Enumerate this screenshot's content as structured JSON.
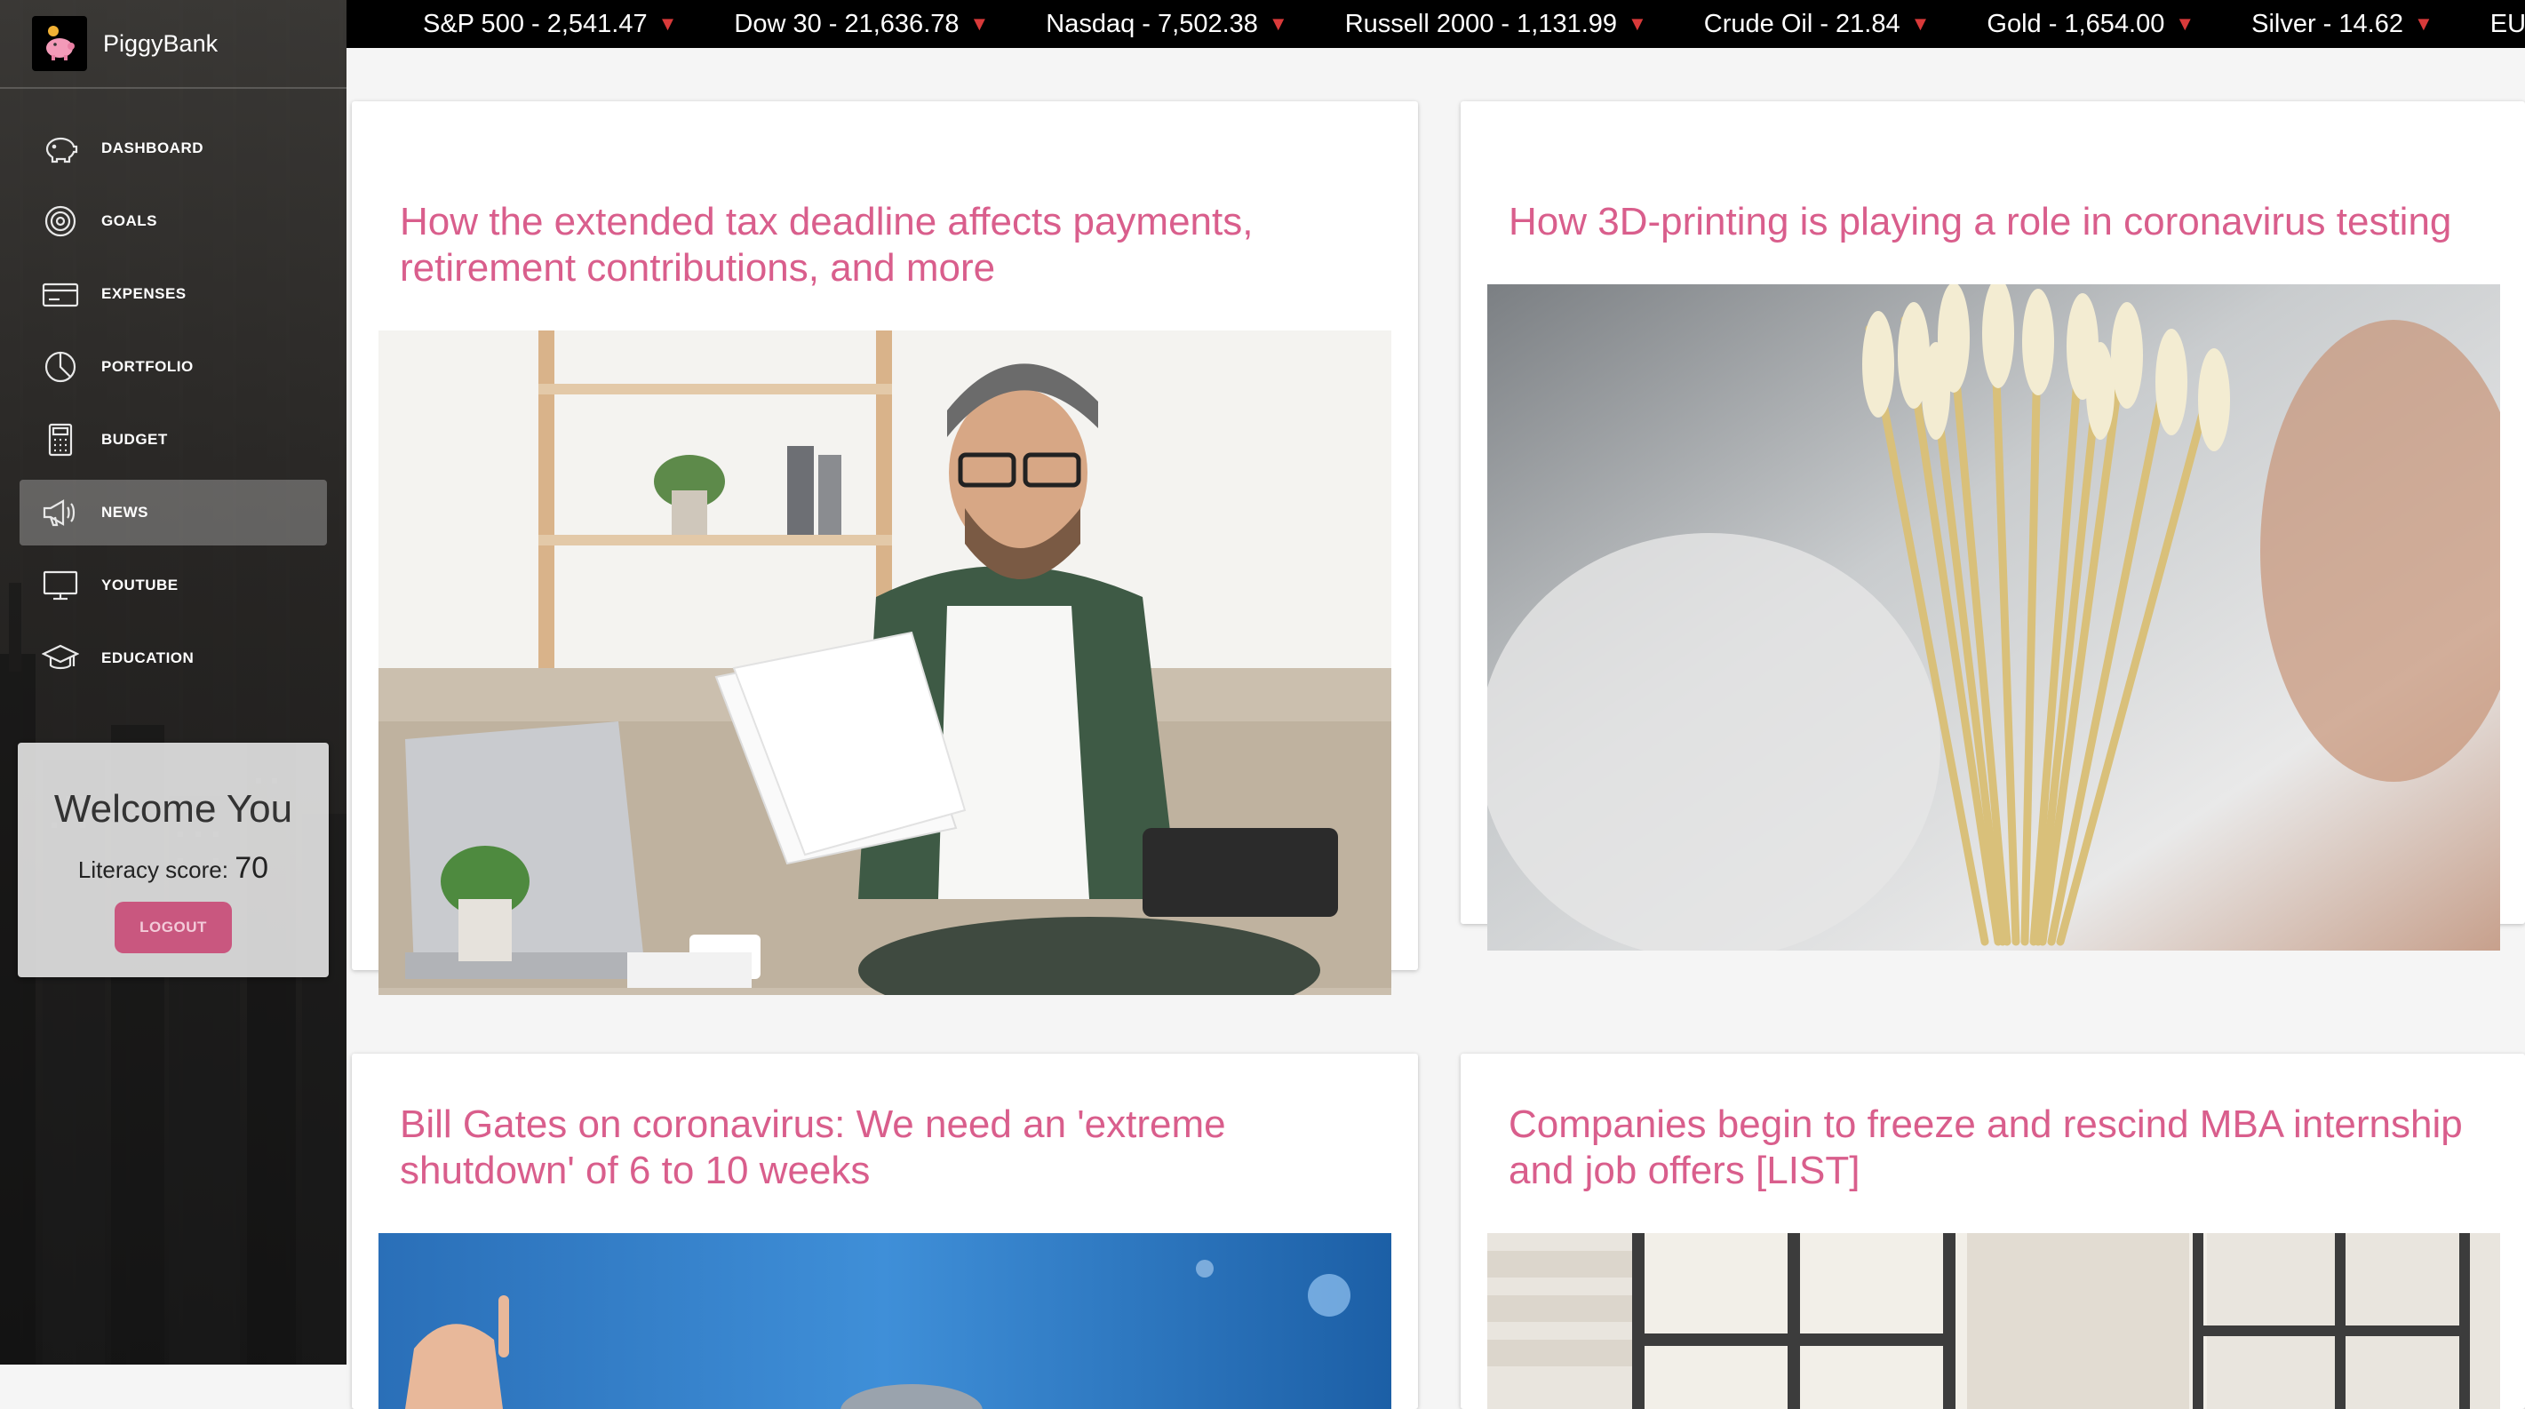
{
  "app": {
    "brand_name": "PiggyBank"
  },
  "sidebar": {
    "items": [
      {
        "label": "DASHBOARD",
        "icon": "piggy-bank-icon",
        "active": false
      },
      {
        "label": "GOALS",
        "icon": "target-icon",
        "active": false
      },
      {
        "label": "EXPENSES",
        "icon": "credit-card-icon",
        "active": false
      },
      {
        "label": "PORTFOLIO",
        "icon": "pie-chart-icon",
        "active": false
      },
      {
        "label": "BUDGET",
        "icon": "calculator-icon",
        "active": false
      },
      {
        "label": "NEWS",
        "icon": "megaphone-icon",
        "active": true
      },
      {
        "label": "YOUTUBE",
        "icon": "monitor-icon",
        "active": false
      },
      {
        "label": "EDUCATION",
        "icon": "graduation-cap-icon",
        "active": false
      }
    ]
  },
  "welcome": {
    "title": "Welcome You",
    "score_label": "Literacy score:",
    "score_value": "70",
    "logout_label": "LOGOUT"
  },
  "ticker": [
    {
      "text": "S&P 500 - 2,541.47",
      "direction": "down"
    },
    {
      "text": "Dow 30 - 21,636.78",
      "direction": "down"
    },
    {
      "text": "Nasdaq - 7,502.38",
      "direction": "down"
    },
    {
      "text": "Russell 2000 - 1,131.99",
      "direction": "down"
    },
    {
      "text": "Crude Oil - 21.84",
      "direction": "down"
    },
    {
      "text": "Gold - 1,654.00",
      "direction": "down"
    },
    {
      "text": "Silver - 14.62",
      "direction": "down"
    },
    {
      "text": "EUR/USD",
      "direction": "none"
    }
  ],
  "ticker_arrow": "▼",
  "news": [
    {
      "title": "How the extended tax deadline affects payments, retirement contributions, and more",
      "image": "man-reviewing-tax-papers"
    },
    {
      "title": "How 3D-printing is playing a role in coronavirus testing",
      "image": "test-swabs"
    },
    {
      "title": "Bill Gates on coronavirus: We need an 'extreme shutdown' of 6 to 10 weeks",
      "image": "speaker-on-stage"
    },
    {
      "title": "Companies begin to freeze and rescind MBA internship and job offers [LIST]",
      "image": "office-window"
    }
  ],
  "colors": {
    "accent": "#d95e8c",
    "ticker_bg": "#000000",
    "ticker_down": "#d93a3a",
    "active_nav": "rgba(255,255,255,0.28)"
  }
}
